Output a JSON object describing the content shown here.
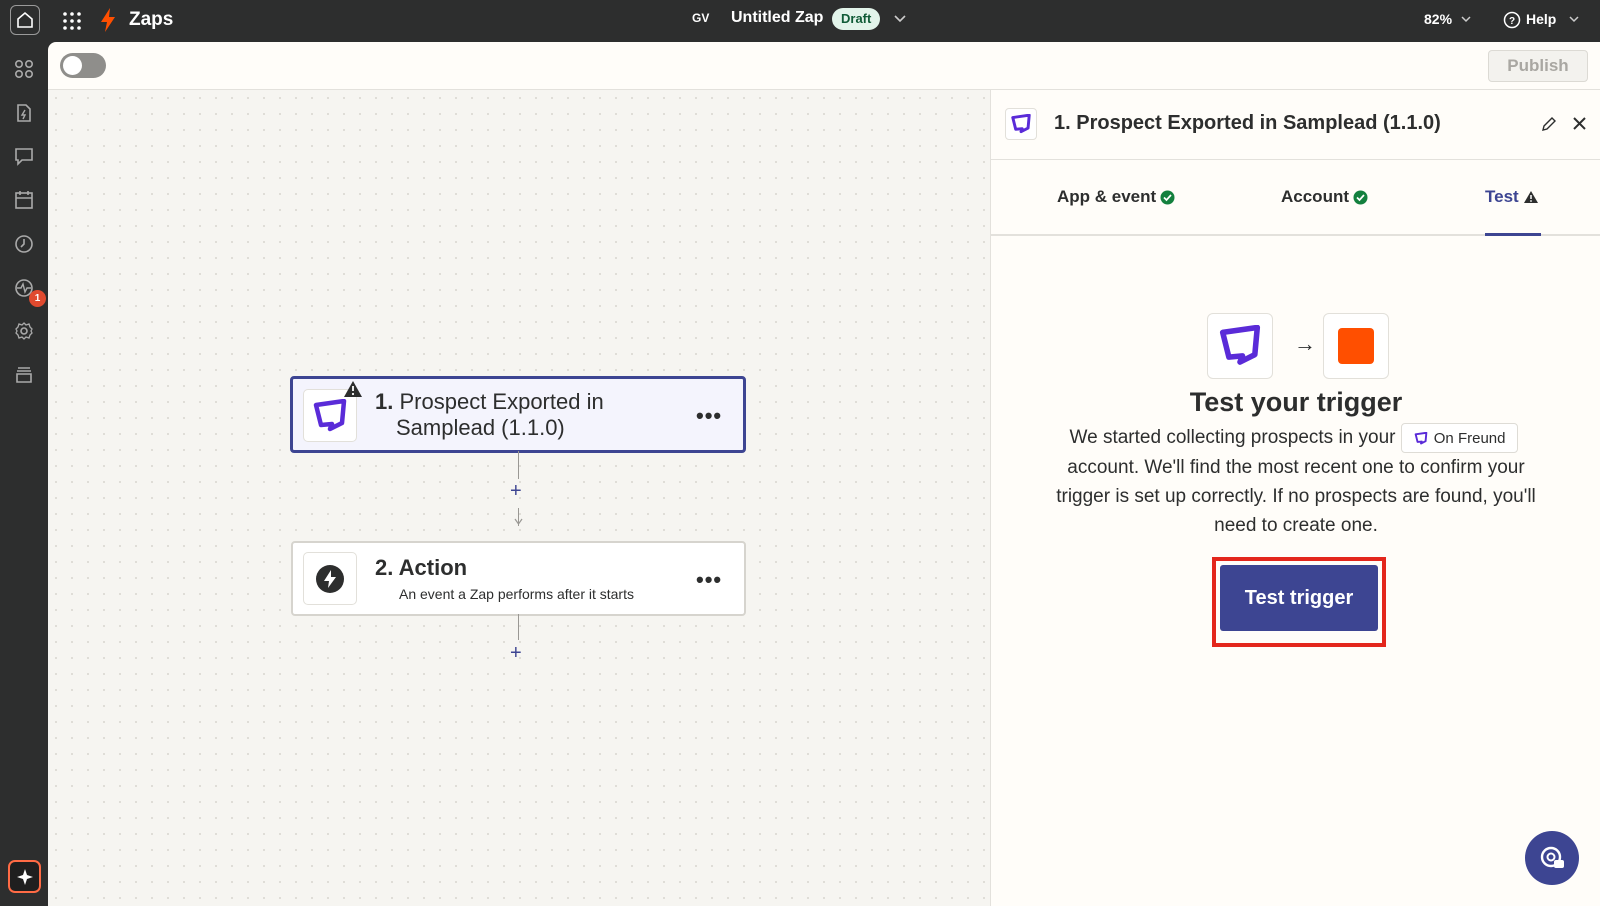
{
  "topbar": {
    "app_name": "Zaps",
    "user_initials": "GV",
    "zap_title": "Untitled Zap",
    "status_badge": "Draft",
    "zoom": "82%",
    "help": "Help"
  },
  "rail": {
    "notification_count": "1"
  },
  "toolbar": {
    "publish_label": "Publish"
  },
  "canvas": {
    "steps": [
      {
        "number": "1.",
        "title_line1": "Prospect Exported in",
        "title_line2": "Samplead (1.1.0)",
        "menu": "•••"
      },
      {
        "number": "2.",
        "title": "Action",
        "subtitle": "An event a Zap performs after it starts",
        "menu": "•••"
      }
    ],
    "add_label": "+"
  },
  "panel": {
    "title": "1. Prospect Exported in Samplead (1.1.0)",
    "tabs": [
      {
        "label": "App & event",
        "status": "complete"
      },
      {
        "label": "Account",
        "status": "complete"
      },
      {
        "label": "Test",
        "status": "warning"
      }
    ],
    "heading": "Test your trigger",
    "desc_before": "We started collecting prospects in your",
    "account_chip": "On Freund",
    "desc_after": "account. We'll find the most recent one to confirm your trigger is set up correctly. If no prospects are found, you'll need to create one.",
    "cta_label": "Test trigger"
  },
  "colors": {
    "brand": "#3d4592",
    "samplead": "#5a2bd8",
    "success": "#13803e",
    "highlight": "#e3261c",
    "zapier_orange": "#ff4f00"
  }
}
